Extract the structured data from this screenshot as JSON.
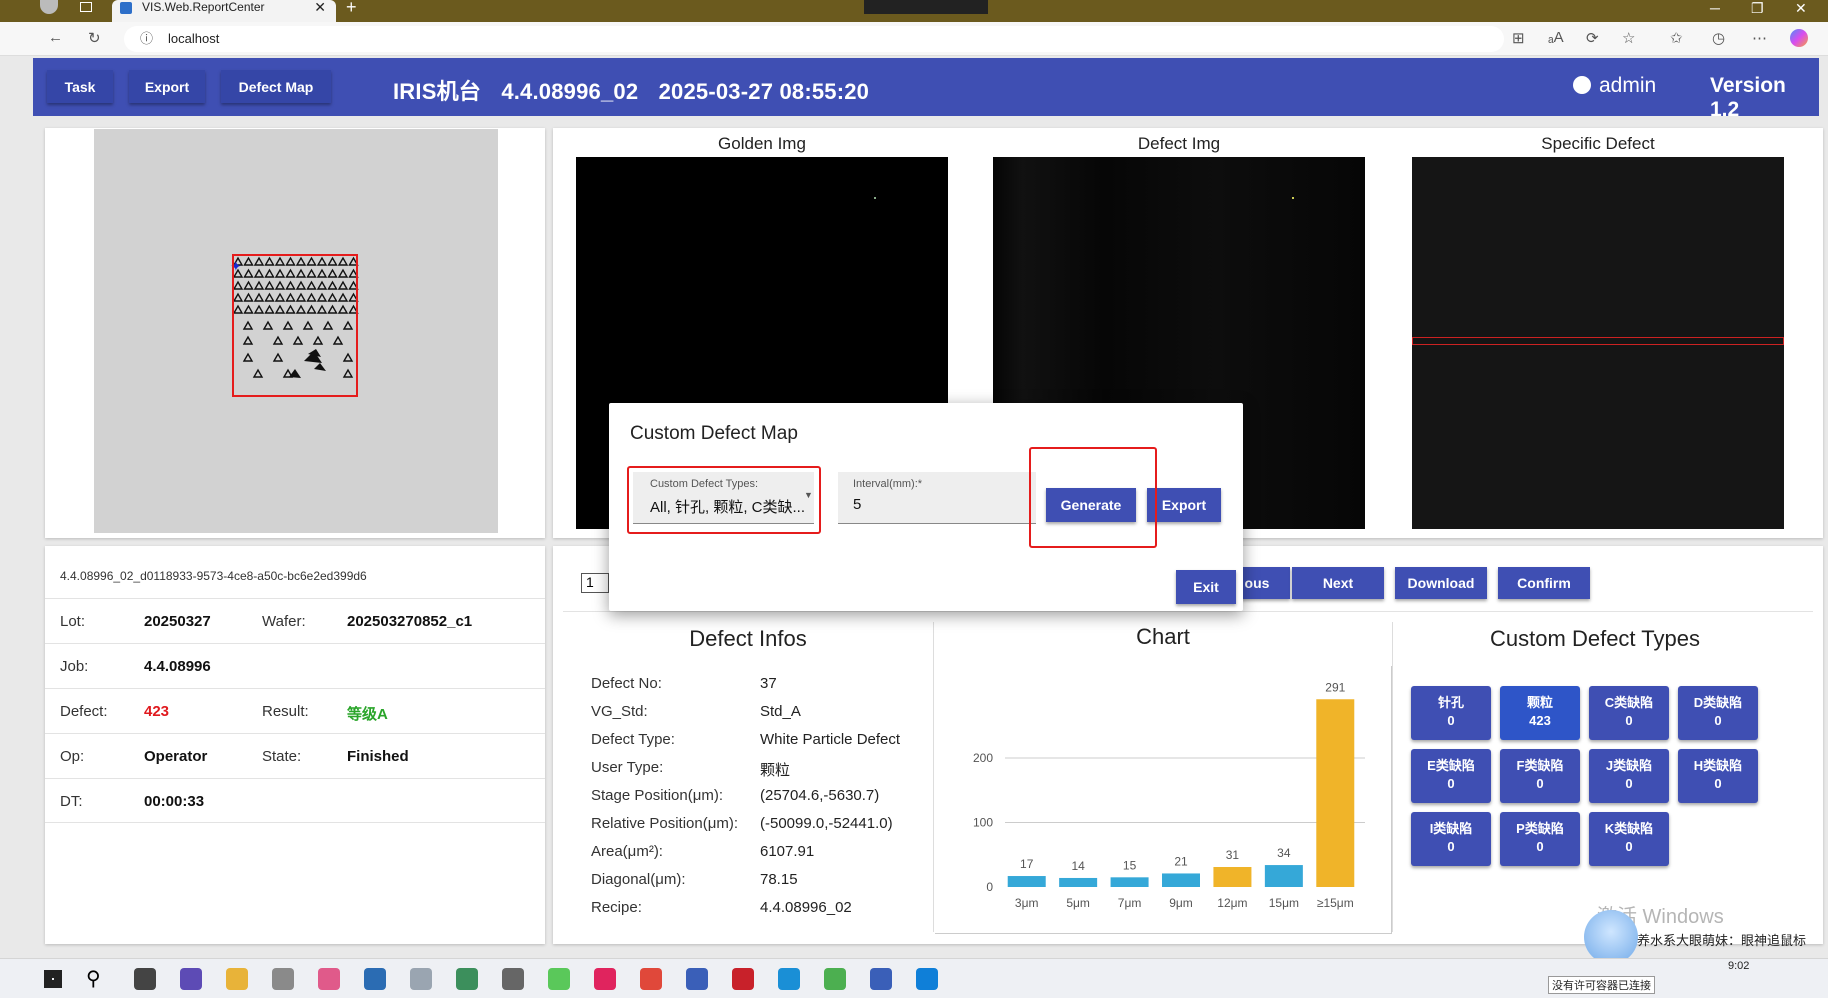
{
  "browser": {
    "tab_title": "VIS.Web.ReportCenter",
    "url": "localhost"
  },
  "header": {
    "buttons": [
      "Task",
      "Export",
      "Defect Map"
    ],
    "machine": "IRIS机台",
    "recipe": "4.4.08996_02",
    "datetime": "2025-03-27 08:55:20",
    "user": "admin",
    "version": "Version 1.2"
  },
  "images": {
    "golden": "Golden Img",
    "defect": "Defect Img",
    "specific": "Specific Defect"
  },
  "wafer_info": {
    "id": "4.4.08996_02_d0118933-9573-4ce8-a50c-bc6e2ed399d6",
    "lot_label": "Lot:",
    "lot": "20250327",
    "wafer_label": "Wafer:",
    "wafer": "202503270852_c1",
    "job_label": "Job:",
    "job": "4.4.08996",
    "defect_label": "Defect:",
    "defect": "423",
    "result_label": "Result:",
    "result": "等级A",
    "op_label": "Op:",
    "op": "Operator",
    "state_label": "State:",
    "state": "Finished",
    "dt_label": "DT:",
    "dt": "00:00:33"
  },
  "nav": {
    "page": "1",
    "previous_partial": "ous",
    "next": "Next",
    "download": "Download",
    "confirm": "Confirm"
  },
  "defect_infos": {
    "title": "Defect Infos",
    "rows": [
      {
        "label": "Defect No:",
        "value": "37"
      },
      {
        "label": "VG_Std:",
        "value": "Std_A"
      },
      {
        "label": "Defect Type:",
        "value": "White Particle Defect"
      },
      {
        "label": "User Type:",
        "value": "颗粒"
      },
      {
        "label": "Stage Position(μm):",
        "value": "(25704.6,-5630.7)"
      },
      {
        "label": "Relative Position(μm):",
        "value": "(-50099.0,-52441.0)"
      },
      {
        "label": "Area(μm²):",
        "value": "6107.91"
      },
      {
        "label": "Diagonal(μm):",
        "value": "78.15"
      },
      {
        "label": "Recipe:",
        "value": "4.4.08996_02"
      }
    ]
  },
  "chart_title": "Chart",
  "chart_data": {
    "type": "bar",
    "categories": [
      "3μm",
      "5μm",
      "7μm",
      "9μm",
      "12μm",
      "15μm",
      "≥15μm"
    ],
    "values": [
      17,
      14,
      15,
      21,
      31,
      34,
      291
    ],
    "colors": [
      "#35a8d8",
      "#35a8d8",
      "#35a8d8",
      "#35a8d8",
      "#f0b429",
      "#35a8d8",
      "#f0b429"
    ],
    "yticks": [
      0,
      100,
      200
    ],
    "ylim": [
      0,
      310
    ],
    "grid": true
  },
  "custom_types": {
    "title": "Custom Defect Types",
    "items": [
      {
        "name": "针孔",
        "count": "0",
        "selected": false
      },
      {
        "name": "颗粒",
        "count": "423",
        "selected": true
      },
      {
        "name": "C类缺陷",
        "count": "0",
        "selected": false
      },
      {
        "name": "D类缺陷",
        "count": "0",
        "selected": false
      },
      {
        "name": "E类缺陷",
        "count": "0",
        "selected": false
      },
      {
        "name": "F类缺陷",
        "count": "0",
        "selected": false
      },
      {
        "name": "J类缺陷",
        "count": "0",
        "selected": false
      },
      {
        "name": "H类缺陷",
        "count": "0",
        "selected": false
      },
      {
        "name": "I类缺陷",
        "count": "0",
        "selected": false
      },
      {
        "name": "P类缺陷",
        "count": "0",
        "selected": false
      },
      {
        "name": "K类缺陷",
        "count": "0",
        "selected": false
      }
    ]
  },
  "modal": {
    "title": "Custom Defect Map",
    "types_label": "Custom Defect Types:",
    "types_value": "All, 针孔, 颗粒, C类缺...",
    "interval_label": "Interval(mm):*",
    "interval_value": "5",
    "generate": "Generate",
    "export": "Export",
    "exit": "Exit"
  },
  "os": {
    "watermark": "激活 Windows",
    "notification": "养水系大眼萌妹：眼神追鼠标",
    "notification2": "没有许可容器已连接",
    "time": "9:02"
  }
}
